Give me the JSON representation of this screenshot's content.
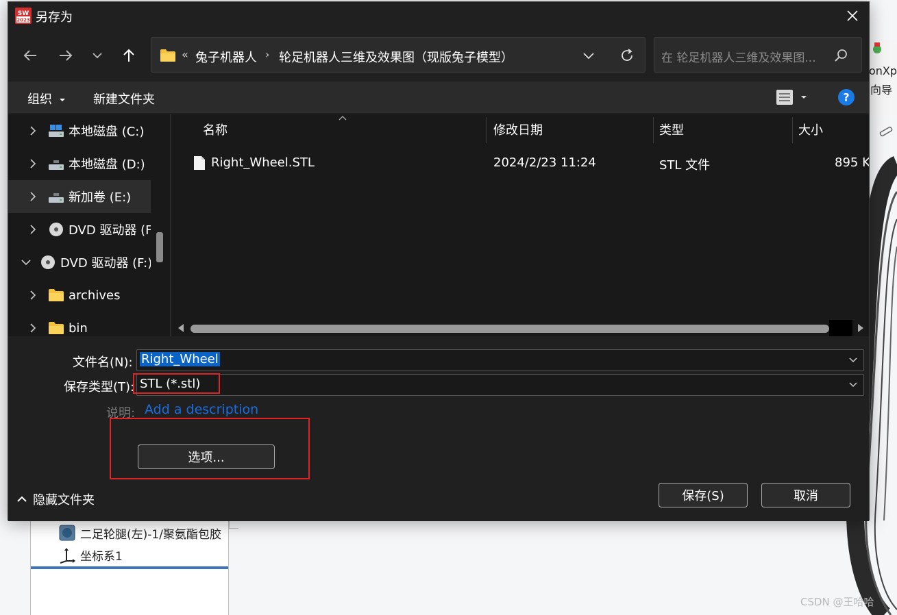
{
  "dialog": {
    "title": "另存为",
    "app_icon_text": "SW 2023"
  },
  "address": {
    "overflow": "«",
    "crumbs": [
      "兔子机器人",
      "轮足机器人三维及效果图（现版兔子模型）"
    ],
    "separator": "›"
  },
  "search": {
    "placeholder": "在 轮足机器人三维及效果图..."
  },
  "commandbar": {
    "organize": "组织",
    "new_folder": "新建文件夹"
  },
  "nav": {
    "items": [
      {
        "label": "本地磁盘 (C:)",
        "icon": "drive-icon",
        "expanded": false
      },
      {
        "label": "本地磁盘 (D:)",
        "icon": "drive-icon",
        "expanded": false
      },
      {
        "label": "新加卷 (E:)",
        "icon": "drive-icon",
        "expanded": false,
        "selected": true
      },
      {
        "label": "DVD 驱动器 (F",
        "icon": "dvd-icon",
        "expanded": false
      },
      {
        "label": "DVD 驱动器 (F:)",
        "icon": "dvd-icon",
        "expanded": true
      },
      {
        "label": "archives",
        "icon": "folder-icon",
        "expanded": false
      },
      {
        "label": "bin",
        "icon": "folder-icon",
        "expanded": false
      }
    ]
  },
  "files": {
    "columns": [
      "名称",
      "修改日期",
      "类型",
      "大小"
    ],
    "rows": [
      {
        "name": "Right_Wheel.STL",
        "modified": "2024/2/23 11:24",
        "type": "STL 文件",
        "size": "895 K"
      }
    ]
  },
  "form": {
    "filename_label": "文件名(N):",
    "filename_value": "Right_Wheel",
    "type_label": "保存类型(T):",
    "type_value": "STL (*.stl)",
    "description_label": "说明:",
    "description_link": "Add a description",
    "options_button": "选项..."
  },
  "footer": {
    "hide_folders": "隐藏文件夹",
    "save": "保存(S)",
    "cancel": "取消"
  },
  "background": {
    "toolbar_text_1": "onXpr",
    "toolbar_text_2": "向导",
    "tree_items": [
      "二足轮腿(左)-1/聚氨酯包胶",
      "坐标系1"
    ],
    "watermark": "CSDN @王哈哈"
  },
  "colors": {
    "dialog_bg": "#202020",
    "pane_bg": "#191919",
    "accent": "#0a64c8",
    "link": "#1a6ee0",
    "highlight_box": "#e02424"
  }
}
